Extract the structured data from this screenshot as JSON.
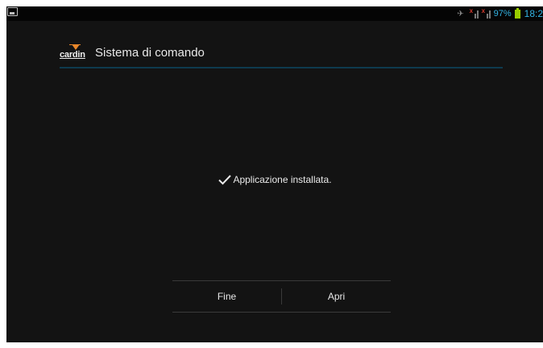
{
  "status_bar": {
    "battery_percent": "97%",
    "time": "18:2",
    "icons": [
      "image-notification-icon",
      "mute-icon",
      "signal-icon",
      "signal-icon",
      "battery-icon"
    ],
    "accent_color": "#33b5e5",
    "battery_color": "#99cc00"
  },
  "header": {
    "brand": "cardin",
    "title": "Sistema di comando",
    "rule_color": "#0e3a4e"
  },
  "main": {
    "message": "Applicazione installata."
  },
  "actions": {
    "done_label": "Fine",
    "open_label": "Apri"
  }
}
